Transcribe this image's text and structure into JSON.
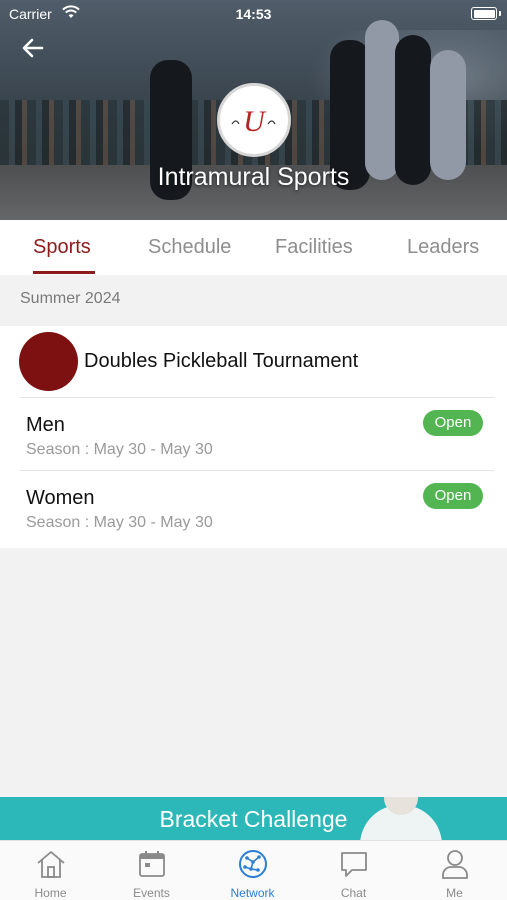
{
  "status_bar": {
    "carrier": "Carrier",
    "time": "14:53"
  },
  "header": {
    "title": "Intramural Sports",
    "logo_text": "U"
  },
  "tabs": [
    {
      "label": "Sports",
      "active": true
    },
    {
      "label": "Schedule",
      "active": false
    },
    {
      "label": "Facilities",
      "active": false
    },
    {
      "label": "Leaders",
      "active": false
    }
  ],
  "section": {
    "title": "Summer 2024"
  },
  "event": {
    "title": "Doubles Pickleball Tournament",
    "avatar_color": "#7d1010",
    "divisions": [
      {
        "name": "Men",
        "season": "Season : May 30 - May 30",
        "status": "Open"
      },
      {
        "name": "Women",
        "season": "Season : May 30 - May 30",
        "status": "Open"
      }
    ]
  },
  "banner": {
    "label": "Bracket Challenge"
  },
  "bottom_nav": [
    {
      "label": "Home",
      "icon": "home-icon",
      "active": false
    },
    {
      "label": "Events",
      "icon": "calendar-icon",
      "active": false
    },
    {
      "label": "Network",
      "icon": "network-icon",
      "active": true
    },
    {
      "label": "Chat",
      "icon": "chat-icon",
      "active": false
    },
    {
      "label": "Me",
      "icon": "person-icon",
      "active": false
    }
  ],
  "colors": {
    "accent": "#8c1c1c",
    "open_badge": "#52b552",
    "banner": "#2cb8b8",
    "nav_active": "#2a7fd4"
  }
}
